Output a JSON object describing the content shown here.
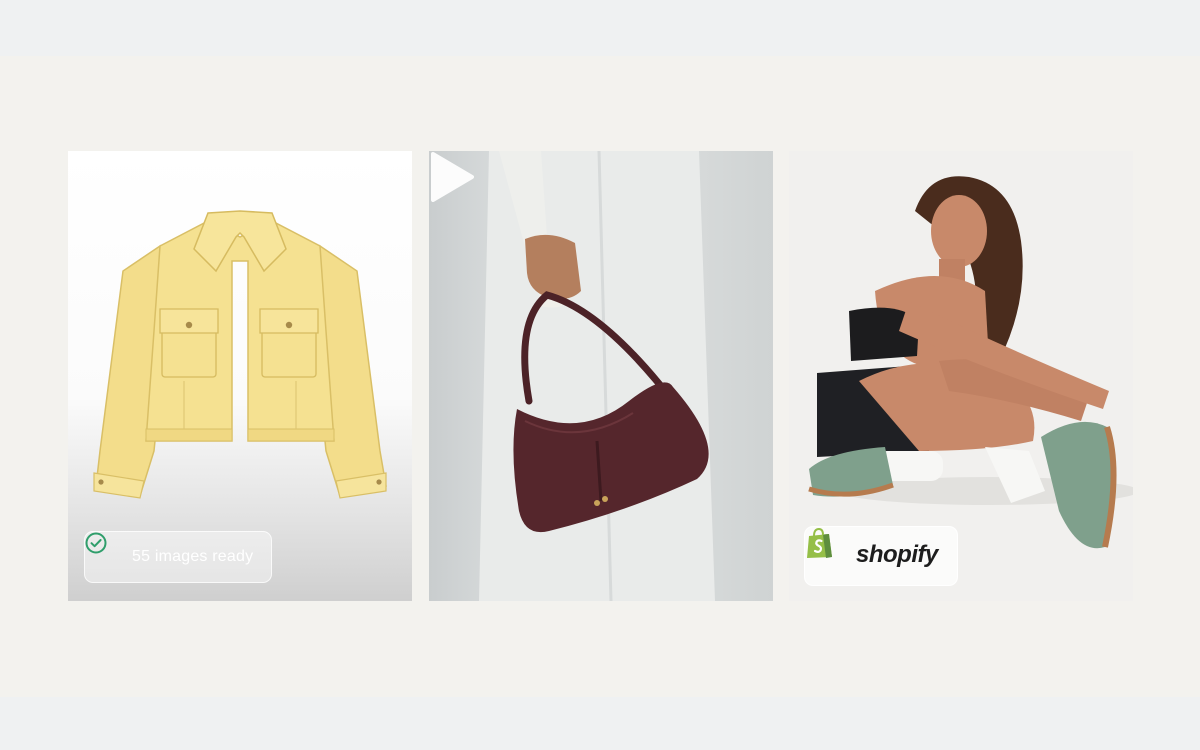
{
  "cards": [
    {
      "image": "yellow-jacket-product-photo",
      "badge": {
        "icon": "check-circle-icon",
        "text": "55 images ready"
      }
    },
    {
      "image": "handbag-model-video-thumbnail",
      "overlay_icon": "play-icon"
    },
    {
      "image": "model-sneakers-lifestyle-photo",
      "badge": {
        "icon": "shopify-bag-icon",
        "text": "shopify"
      }
    }
  ],
  "colors": {
    "background": "#f3f2ee",
    "band": "#eff1f2",
    "check_green": "#2f9e6b",
    "shopify_green": "#95bf47"
  }
}
